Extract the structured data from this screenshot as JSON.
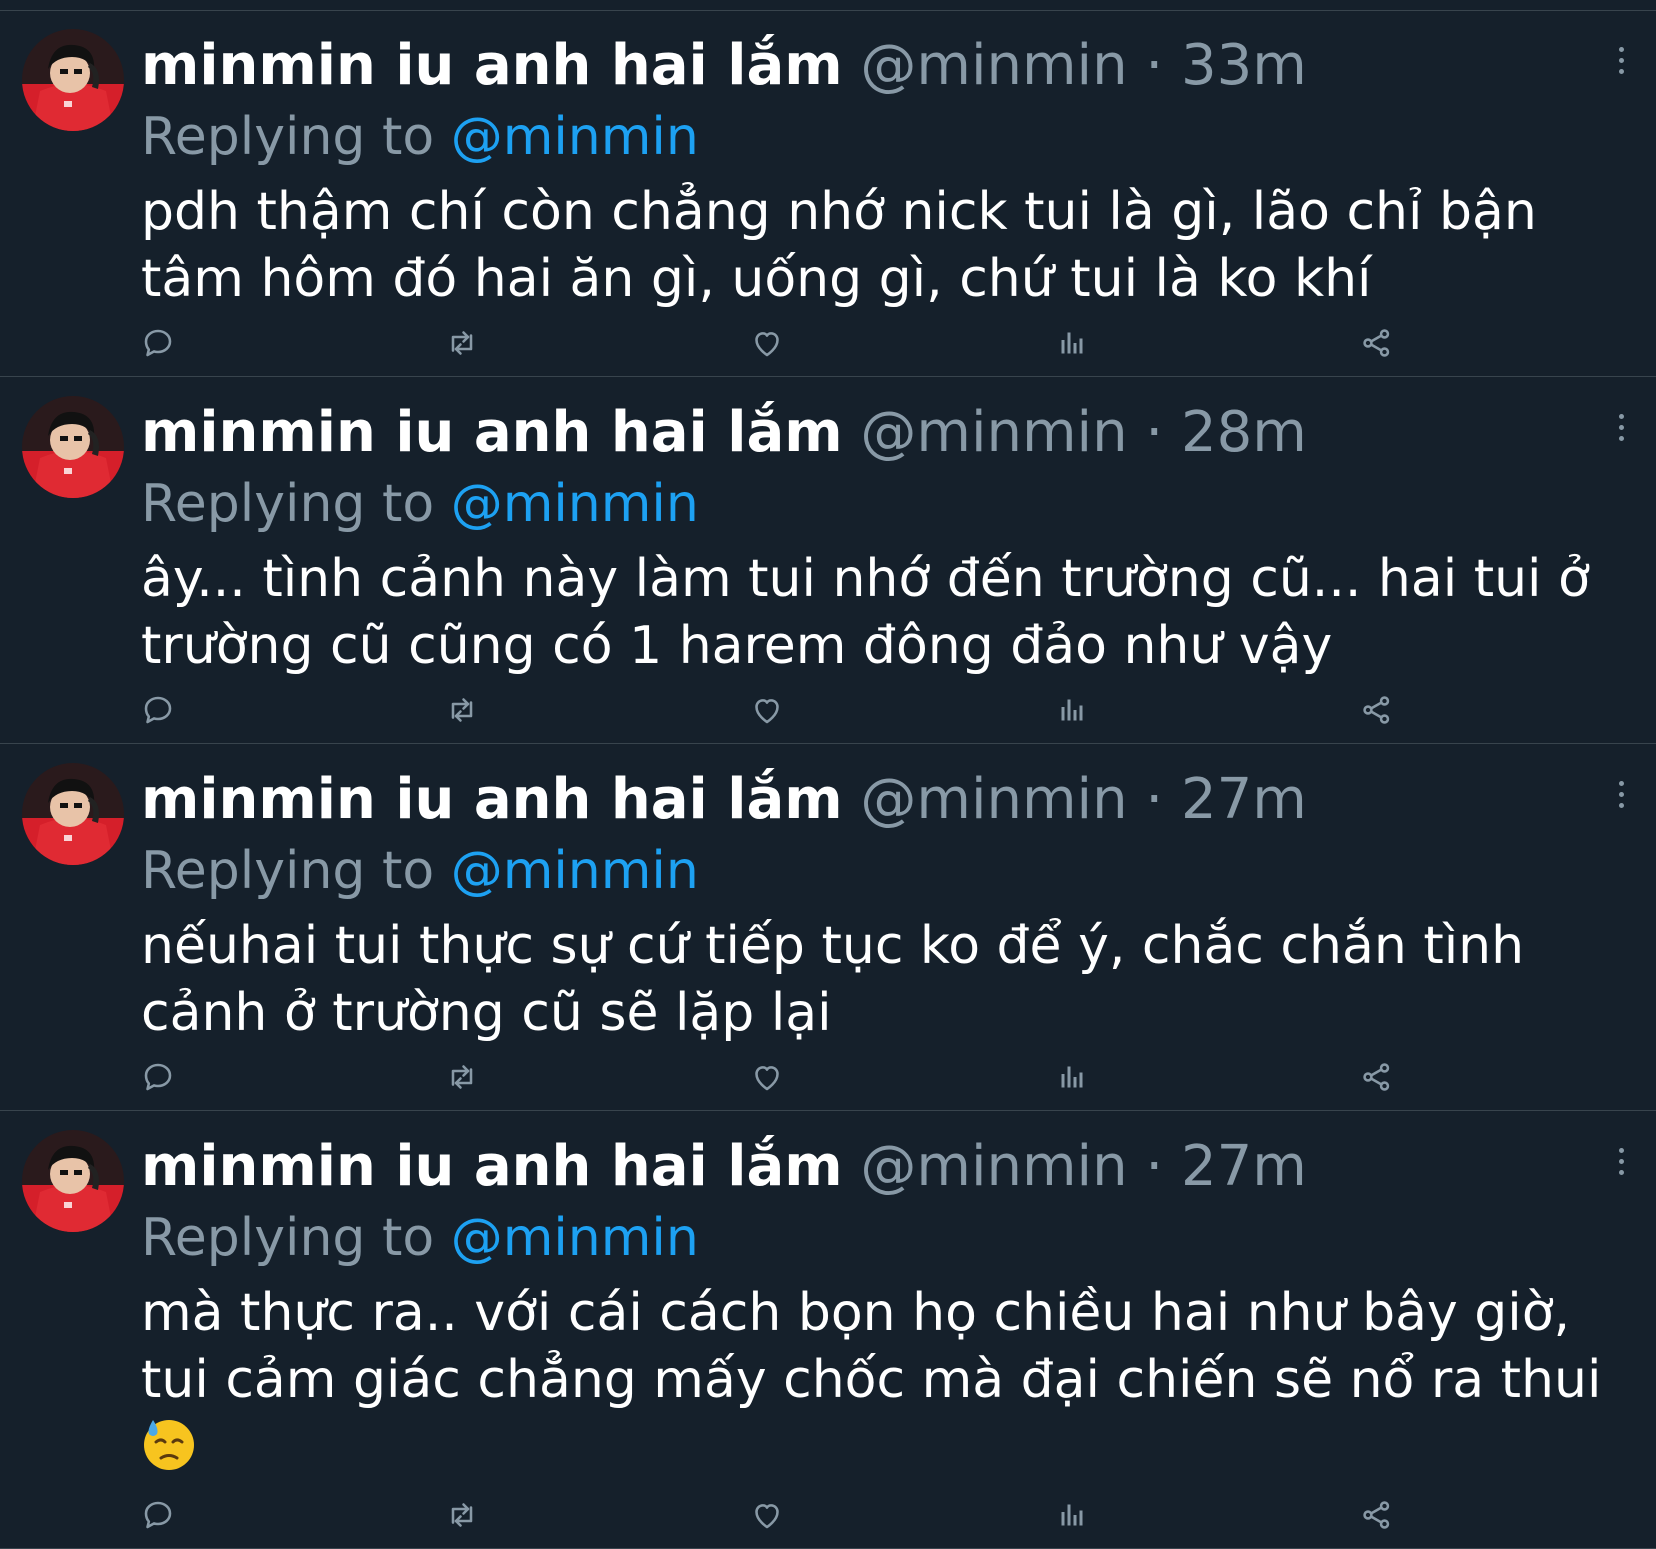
{
  "theme": {
    "background": "#15202b",
    "divider": "#38444d",
    "text_primary": "#ffffff",
    "text_secondary": "#8899a6",
    "accent": "#1da1f2"
  },
  "tweets": [
    {
      "display_name": "minmin iu anh hai lắm",
      "handle": "@minmin",
      "separator": "·",
      "time": "33m",
      "replying_label": "Replying to",
      "replying_to": "@minmin",
      "text": "pdh thậm chí còn chẳng nhớ nick tui là gì, lão chỉ bận tâm hôm đó hai ăn gì, uống gì, chứ tui là ko khí",
      "icons": [
        "avatar",
        "more-icon",
        "reply-icon",
        "retweet-icon",
        "like-icon",
        "analytics-icon",
        "share-icon"
      ]
    },
    {
      "display_name": "minmin iu anh hai lắm",
      "handle": "@minmin",
      "separator": "·",
      "time": "28m",
      "replying_label": "Replying to",
      "replying_to": "@minmin",
      "text": "ây... tình cảnh này làm tui nhớ đến trường cũ... hai tui ở trường cũ cũng có 1 harem đông đảo như vậy",
      "icons": [
        "avatar",
        "more-icon",
        "reply-icon",
        "retweet-icon",
        "like-icon",
        "analytics-icon",
        "share-icon"
      ]
    },
    {
      "display_name": "minmin iu anh hai lắm",
      "handle": "@minmin",
      "separator": "·",
      "time": "27m",
      "replying_label": "Replying to",
      "replying_to": "@minmin",
      "text": "nếuhai tui thực sự cứ tiếp tục ko để ý, chắc chắn tình cảnh ở trường cũ sẽ lặp lại",
      "icons": [
        "avatar",
        "more-icon",
        "reply-icon",
        "retweet-icon",
        "like-icon",
        "analytics-icon",
        "share-icon"
      ]
    },
    {
      "display_name": "minmin iu anh hai lắm",
      "handle": "@minmin",
      "separator": "·",
      "time": "27m",
      "replying_label": "Replying to",
      "replying_to": "@minmin",
      "text": "mà thực ra.. với cái cách bọn họ chiều hai như bây giờ, tui cảm giác chẳng mấy chốc mà đại chiến sẽ nổ ra thui",
      "emoji": "downcast-face-with-sweat-emoji",
      "icons": [
        "avatar",
        "more-icon",
        "reply-icon",
        "retweet-icon",
        "like-icon",
        "analytics-icon",
        "share-icon"
      ]
    }
  ]
}
